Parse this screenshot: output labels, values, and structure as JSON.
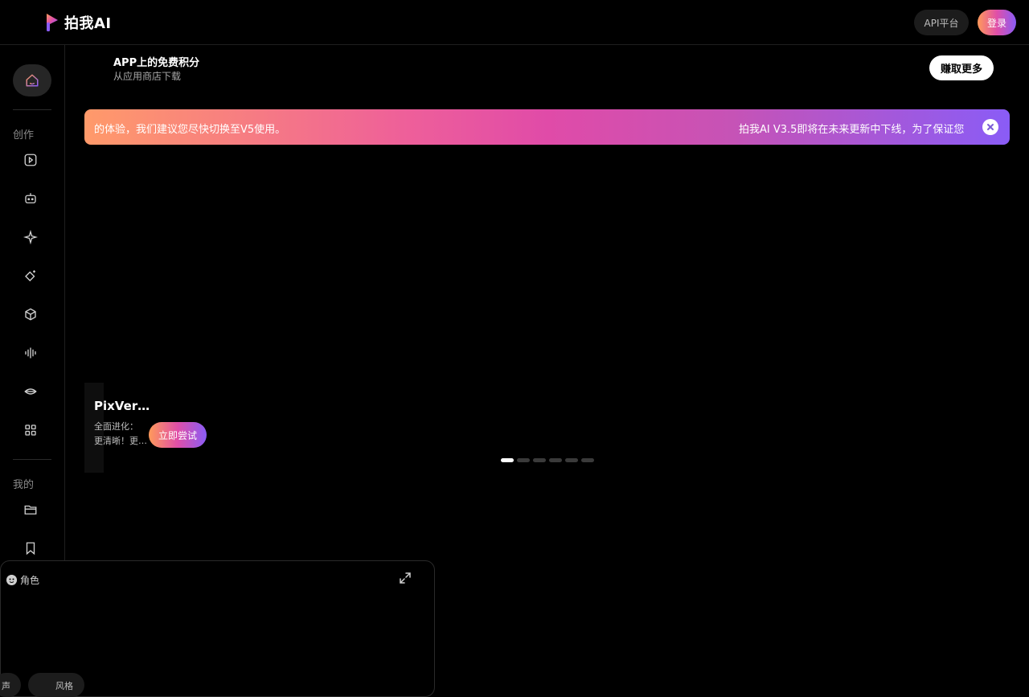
{
  "header": {
    "logo_text": "拍我AI",
    "api_label": "API平台",
    "login_label": "登录"
  },
  "sidebar": {
    "section_create": "创作",
    "section_mine": "我的",
    "icons": [
      "home-icon",
      "video-add-icon",
      "robot-icon",
      "sparkle-icon",
      "magic-eraser-icon",
      "cube-icon",
      "audio-wave-icon",
      "lips-icon",
      "grid-icon",
      "folder-icon",
      "bookmark-icon"
    ]
  },
  "promo": {
    "title": "APP上的免费积分",
    "subtitle": "从应用商店下载",
    "earn_label": "赚取更多"
  },
  "banner": {
    "text_left": "的体验，我们建议您尽快切换至V5使用。",
    "text_right": "拍我AI V3.5即将在未来更新中下线，为了保证您"
  },
  "carousel": {
    "title": "PixVer…",
    "desc_line1": "全面进化：",
    "desc_line2": "更清晰！更…",
    "try_label": "立即尝试",
    "slide_count": 6,
    "active_index": 0
  },
  "panel": {
    "role_label": "角色",
    "chip_left": "声",
    "chip_style": "风格"
  },
  "colors": {
    "accent_start": "#ff9a5a",
    "accent_mid": "#e04fa8",
    "accent_end": "#8a5cf6"
  }
}
